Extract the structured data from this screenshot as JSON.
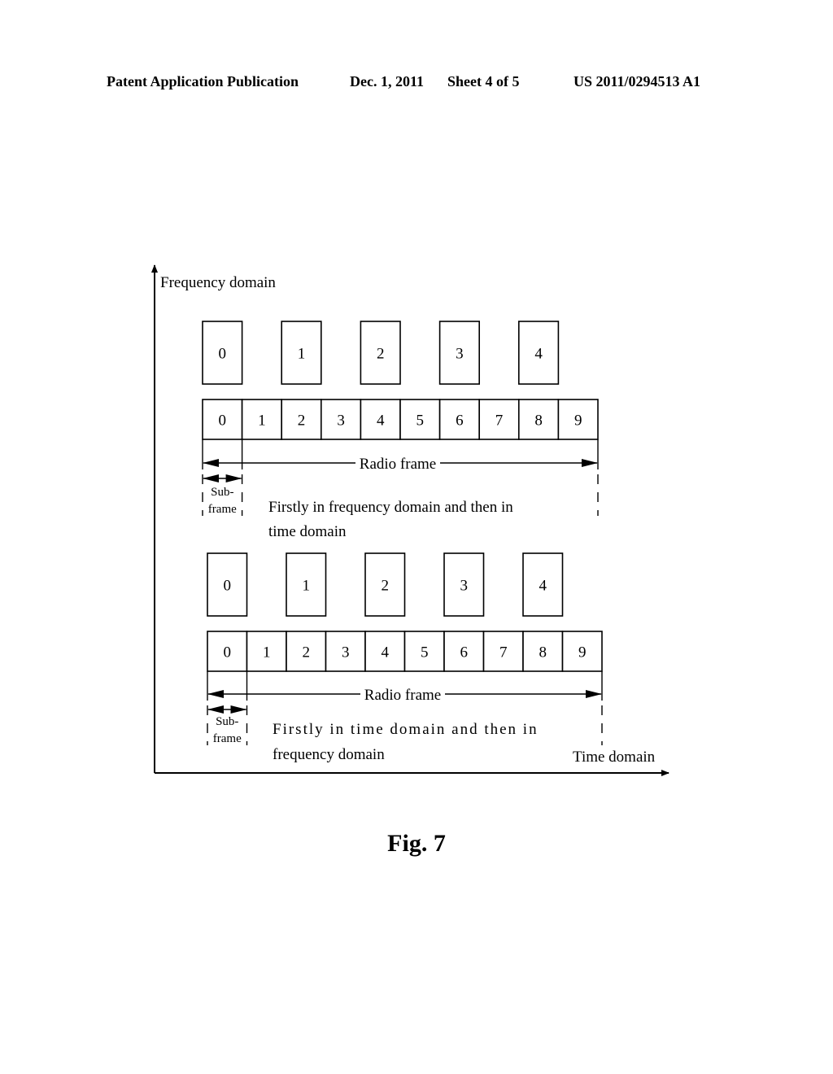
{
  "header": {
    "publication": "Patent Application Publication",
    "date": "Dec. 1, 2011",
    "sheet": "Sheet 4 of 5",
    "number": "US 2011/0294513 A1"
  },
  "diagram": {
    "y_axis_label": "Frequency domain",
    "x_axis_label": "Time domain",
    "panels": [
      {
        "resource_blocks": [
          "0",
          "1",
          "2",
          "3",
          "4"
        ],
        "subframes": [
          "0",
          "1",
          "2",
          "3",
          "4",
          "5",
          "6",
          "7",
          "8",
          "9"
        ],
        "radio_frame_label": "Radio frame",
        "subframe_label_line1": "Sub-",
        "subframe_label_line2": "frame",
        "caption_line1": "Firstly in frequency domain and then in",
        "caption_line2": "time domain"
      },
      {
        "resource_blocks": [
          "0",
          "1",
          "2",
          "3",
          "4"
        ],
        "subframes": [
          "0",
          "1",
          "2",
          "3",
          "4",
          "5",
          "6",
          "7",
          "8",
          "9"
        ],
        "radio_frame_label": "Radio frame",
        "subframe_label_line1": "Sub-",
        "subframe_label_line2": "frame",
        "caption_line1": "Firstly in time domain and then in",
        "caption_line2": "frequency domain"
      }
    ]
  },
  "figure_label": "Fig. 7"
}
